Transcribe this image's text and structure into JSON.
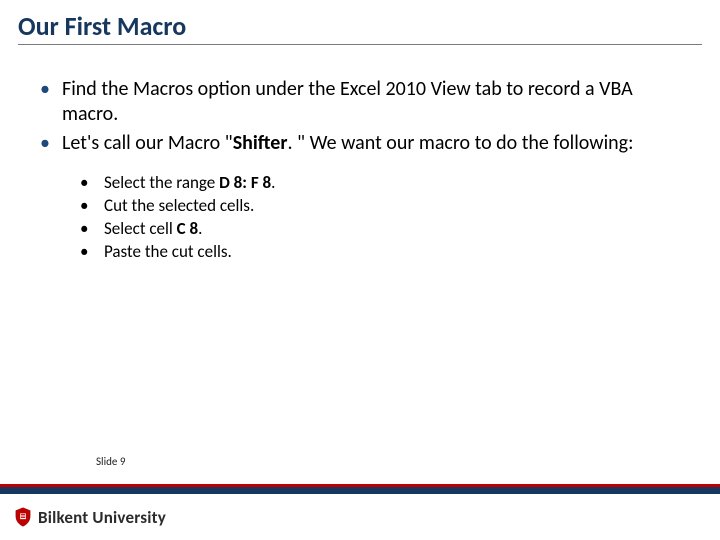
{
  "title": "Our First Macro",
  "bullets": {
    "b1": "Find the Macros option under the Excel 2010 View tab to record a VBA macro.",
    "b2_pre": "Let's call our Macro \"",
    "b2_bold": "Shifter",
    "b2_post": ". \"  We want our macro to do the following:"
  },
  "subs": {
    "s1_pre": "Select the range ",
    "s1_bold": "D 8: F 8",
    "s1_post": ".",
    "s2": "Cut the selected cells.",
    "s3_pre": "Select cell ",
    "s3_bold": "C 8",
    "s3_post": ".",
    "s4": "Paste the cut cells."
  },
  "footer": {
    "slide": "Slide 9",
    "university": "Bilkent University"
  }
}
